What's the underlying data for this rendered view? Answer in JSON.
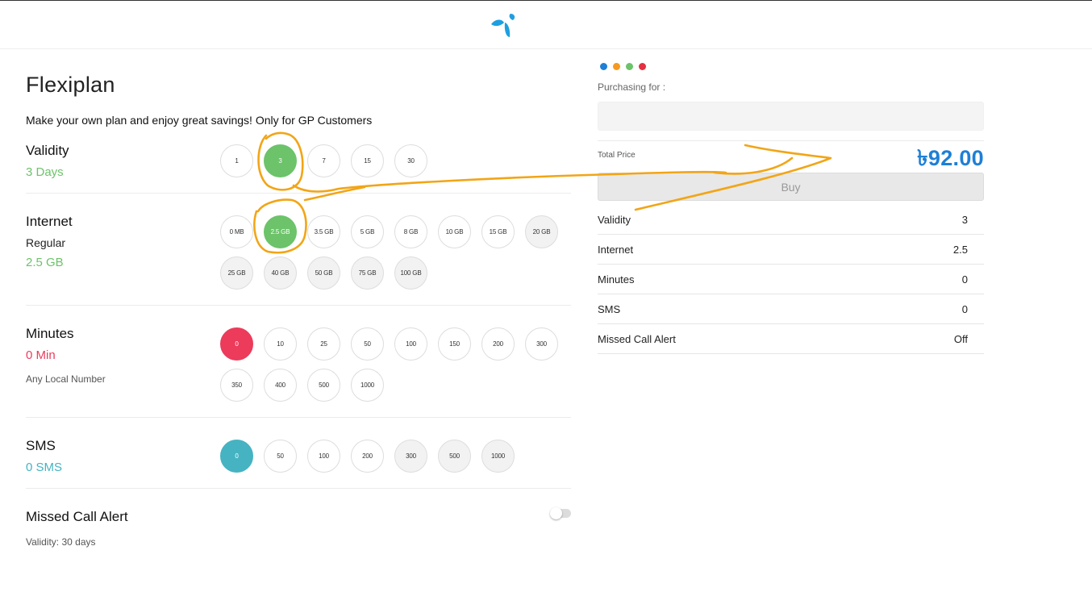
{
  "brand": {
    "logo_color": "#1e9fe0"
  },
  "title": "Flexiplan",
  "subtitle": "Make your own plan and enjoy great savings! Only for GP Customers",
  "validity": {
    "title": "Validity",
    "value": "3 Days",
    "value_color": "#6cc36a",
    "options": [
      "1",
      "3",
      "7",
      "15",
      "30"
    ],
    "selected": "3"
  },
  "internet": {
    "title": "Internet",
    "sub": "Regular",
    "value": "2.5 GB",
    "value_color": "#6cc36a",
    "options": [
      "0 MB",
      "2.5 GB",
      "3.5 GB",
      "5 GB",
      "8 GB",
      "10 GB",
      "15 GB",
      "20 GB",
      "25 GB",
      "40 GB",
      "50 GB",
      "75 GB",
      "100 GB"
    ],
    "selected": "2.5 GB"
  },
  "minutes": {
    "title": "Minutes",
    "value": "0 Min",
    "value_color": "#ec3b5b",
    "note": "Any Local Number",
    "options": [
      "0",
      "10",
      "25",
      "50",
      "100",
      "150",
      "200",
      "300",
      "350",
      "400",
      "500",
      "1000"
    ],
    "selected": "0"
  },
  "sms": {
    "title": "SMS",
    "value": "0 SMS",
    "value_color": "#45b3c2",
    "options": [
      "0",
      "50",
      "100",
      "200",
      "300",
      "500",
      "1000"
    ],
    "selected": "0"
  },
  "missed_call": {
    "title": "Missed Call Alert",
    "note": "Validity: 30 days",
    "toggle_on": false
  },
  "cart": {
    "dots": [
      "#1e7fd6",
      "#f59a23",
      "#6cc36a",
      "#e5303f"
    ],
    "purchasing_label": "Purchasing for :",
    "purchasing_value": "",
    "total_label": "Total Price",
    "total_price": "৳92.00",
    "buy_label": "Buy",
    "summary": [
      {
        "label": "Validity",
        "value": "3"
      },
      {
        "label": "Internet",
        "value": "2.5"
      },
      {
        "label": "Minutes",
        "value": "0"
      },
      {
        "label": "SMS",
        "value": "0"
      },
      {
        "label": "Missed Call Alert",
        "value": "Off"
      }
    ]
  }
}
